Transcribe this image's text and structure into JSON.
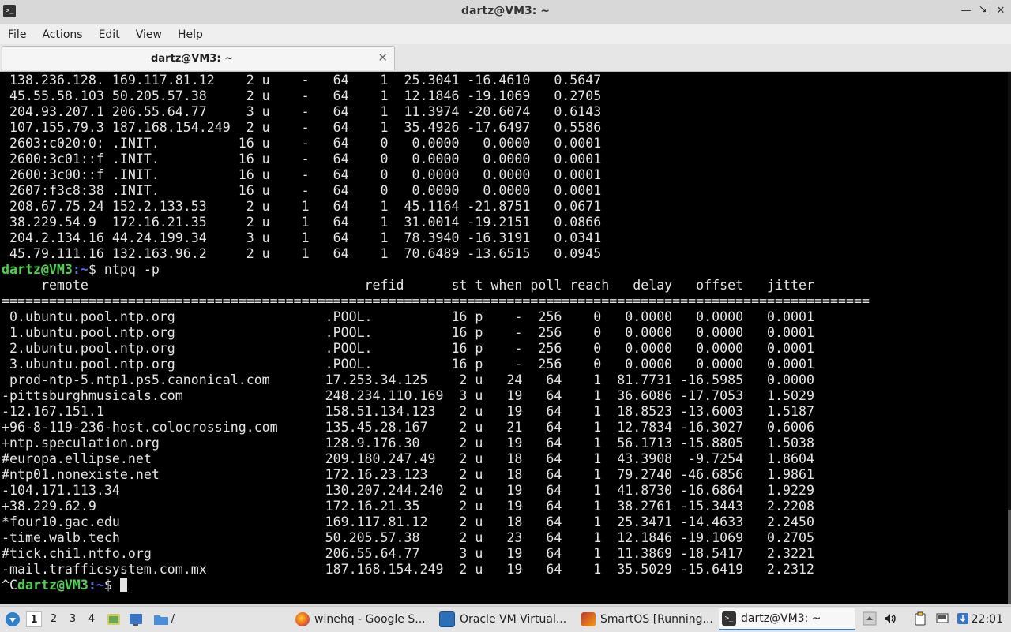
{
  "window": {
    "title": "dartz@VM3: ~"
  },
  "menu": {
    "items": [
      "File",
      "Actions",
      "Edit",
      "View",
      "Help"
    ]
  },
  "tab": {
    "label": "dartz@VM3: ~"
  },
  "terminal": {
    "lines": [
      {
        "text": " 138.236.128. 169.117.81.12    2 u    -   64    1  25.3041 -16.4610   0.5647"
      },
      {
        "text": " 45.55.58.103 50.205.57.38     2 u    -   64    1  12.1846 -19.1069   0.2705"
      },
      {
        "text": " 204.93.207.1 206.55.64.77     3 u    -   64    1  11.3974 -20.6074   0.6143"
      },
      {
        "text": " 107.155.79.3 187.168.154.249  2 u    -   64    1  35.4926 -17.6497   0.5586"
      },
      {
        "text": " 2603:c020:0: .INIT.          16 u    -   64    0   0.0000   0.0000   0.0001"
      },
      {
        "text": " 2600:3c01::f .INIT.          16 u    -   64    0   0.0000   0.0000   0.0001"
      },
      {
        "text": " 2600:3c00::f .INIT.          16 u    -   64    0   0.0000   0.0000   0.0001"
      },
      {
        "text": " 2607:f3c8:38 .INIT.          16 u    -   64    0   0.0000   0.0000   0.0001"
      },
      {
        "text": " 208.67.75.24 152.2.133.53     2 u    1   64    1  45.1164 -21.8751   0.0671"
      },
      {
        "text": " 38.229.54.9  172.16.21.35     2 u    1   64    1  31.0014 -19.2151   0.0866"
      },
      {
        "text": " 204.2.134.16 44.24.199.34     3 u    1   64    1  78.3940 -16.3191   0.0341"
      },
      {
        "text": " 45.79.111.16 132.163.96.2     2 u    1   64    1  70.6489 -13.6515   0.0945"
      },
      {
        "prompt": {
          "user": "dartz@VM3",
          "path": ":~",
          "sep": "$ ",
          "command": "ntpq -p"
        }
      },
      {
        "text": "     remote                                   refid      st t when poll reach   delay   offset   jitter"
      },
      {
        "text": "=============================================================================================================="
      },
      {
        "text": " 0.ubuntu.pool.ntp.org                   .POOL.          16 p    -  256    0   0.0000   0.0000   0.0001"
      },
      {
        "text": " 1.ubuntu.pool.ntp.org                   .POOL.          16 p    -  256    0   0.0000   0.0000   0.0001"
      },
      {
        "text": " 2.ubuntu.pool.ntp.org                   .POOL.          16 p    -  256    0   0.0000   0.0000   0.0001"
      },
      {
        "text": " 3.ubuntu.pool.ntp.org                   .POOL.          16 p    -  256    0   0.0000   0.0000   0.0001"
      },
      {
        "text": " prod-ntp-5.ntp1.ps5.canonical.com       17.253.34.125    2 u   24   64    1  81.7731 -16.5985   0.0000"
      },
      {
        "text": "-pittsburghmusicals.com                  248.234.110.169  3 u   19   64    1  36.6086 -17.7053   1.5029"
      },
      {
        "text": "-12.167.151.1                            158.51.134.123   2 u   19   64    1  18.8523 -13.6003   1.5187"
      },
      {
        "text": "+96-8-119-236-host.colocrossing.com      135.45.28.167    2 u   21   64    1  12.7834 -16.3027   0.6006"
      },
      {
        "text": "+ntp.speculation.org                     128.9.176.30     2 u   19   64    1  56.1713 -15.8805   1.5038"
      },
      {
        "text": "#europa.ellipse.net                      209.180.247.49   2 u   18   64    1  43.3908  -9.7254   1.8604"
      },
      {
        "text": "#ntp01.nonexiste.net                     172.16.23.123    2 u   18   64    1  79.2740 -46.6856   1.9861"
      },
      {
        "text": "-104.171.113.34                          130.207.244.240  2 u   19   64    1  41.8730 -16.6864   1.9229"
      },
      {
        "text": "+38.229.62.9                             172.16.21.35     2 u   19   64    1  38.2761 -15.3443   2.2208"
      },
      {
        "text": "*four10.gac.edu                          169.117.81.12    2 u   18   64    1  25.3471 -14.4633   2.2450"
      },
      {
        "text": "-time.walb.tech                          50.205.57.38     2 u   23   64    1  12.1846 -19.1069   0.2705"
      },
      {
        "text": "#tick.chi1.ntfo.org                      206.55.64.77     3 u   19   64    1  11.3869 -18.5417   2.3221"
      },
      {
        "text": "-mail.trafficsystem.com.mx               187.168.154.249  2 u   19   64    1  35.5029 -15.6419   2.2312"
      },
      {
        "prompt": {
          "pre": "^C",
          "user": "dartz@VM3",
          "path": ":~",
          "sep": "$ ",
          "command": "",
          "cursor": true
        }
      }
    ]
  },
  "taskbar": {
    "desktops": [
      "1",
      "2",
      "3",
      "4"
    ],
    "active_desktop": 0,
    "folder_label": "/",
    "tasks": [
      {
        "label": "winehq - Google S...",
        "icon": "firefox-icon",
        "color": "#e8621a"
      },
      {
        "label": "Oracle VM Virtual...",
        "icon": "virtualbox-icon",
        "color": "#2a6fb8"
      },
      {
        "label": "SmartOS [Running...",
        "icon": "smartos-vm-icon",
        "color": "#c0392b"
      },
      {
        "label": "dartz@VM3: ~",
        "icon": "terminal-icon",
        "color": "#333333",
        "active": true
      }
    ],
    "clock": "22:01"
  }
}
